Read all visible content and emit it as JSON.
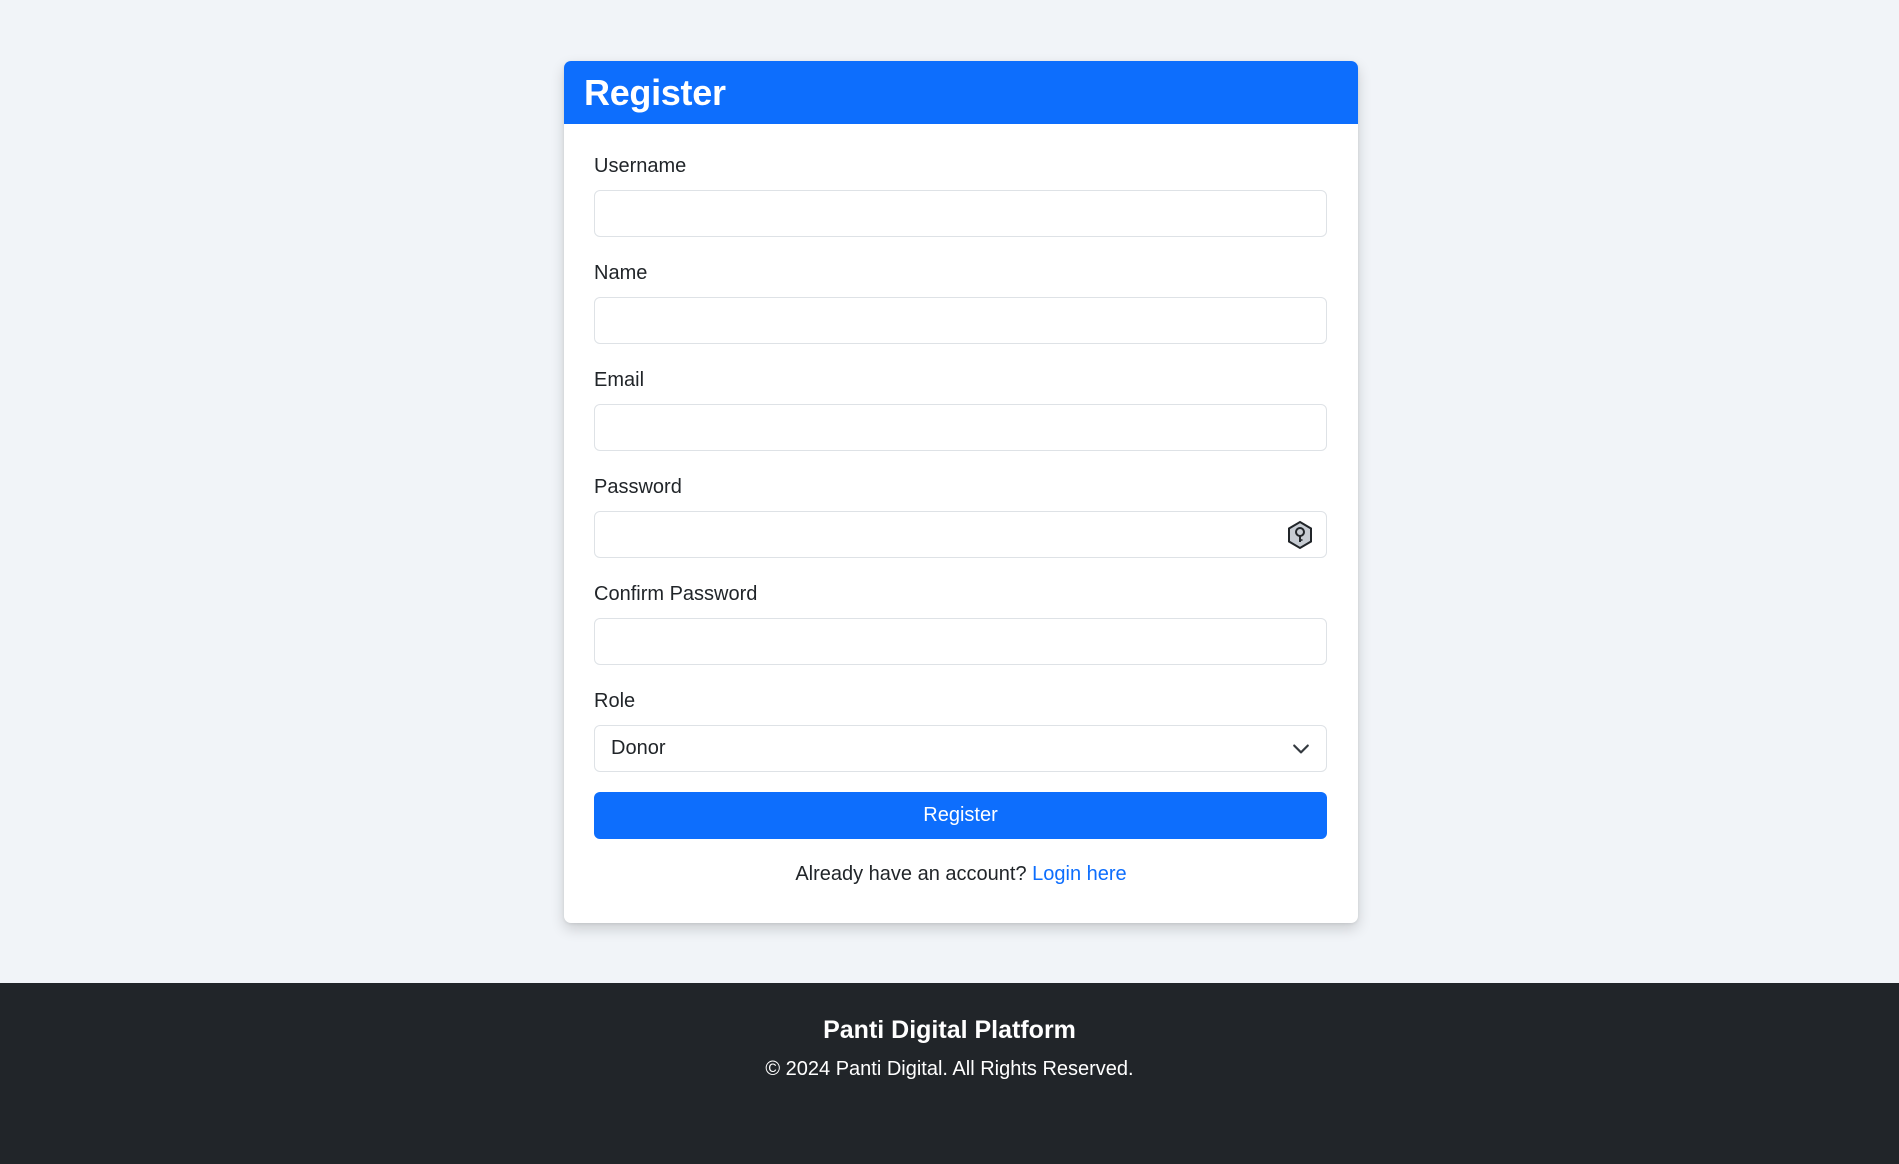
{
  "header": {
    "title": "Register"
  },
  "form": {
    "fields": [
      {
        "label": "Username",
        "value": "",
        "placeholder": ""
      },
      {
        "label": "Name",
        "value": "",
        "placeholder": ""
      },
      {
        "label": "Email",
        "value": "",
        "placeholder": ""
      },
      {
        "label": "Password",
        "value": "",
        "placeholder": ""
      },
      {
        "label": "Confirm Password",
        "value": "",
        "placeholder": ""
      }
    ],
    "role": {
      "label": "Role",
      "selected": "Donor"
    },
    "submit_label": "Register",
    "login_prompt": "Already have an account?",
    "login_link": "Login here"
  },
  "footer": {
    "title": "Panti Digital Platform",
    "copyright": "© 2024 Panti Digital. All Rights Reserved."
  },
  "icons": {
    "password_field": "password-manager-key-icon",
    "role_select": "chevron-down-icon"
  },
  "colors": {
    "primary": "#0d6efd",
    "page_bg": "#f1f4f8",
    "footer_bg": "#212529"
  }
}
